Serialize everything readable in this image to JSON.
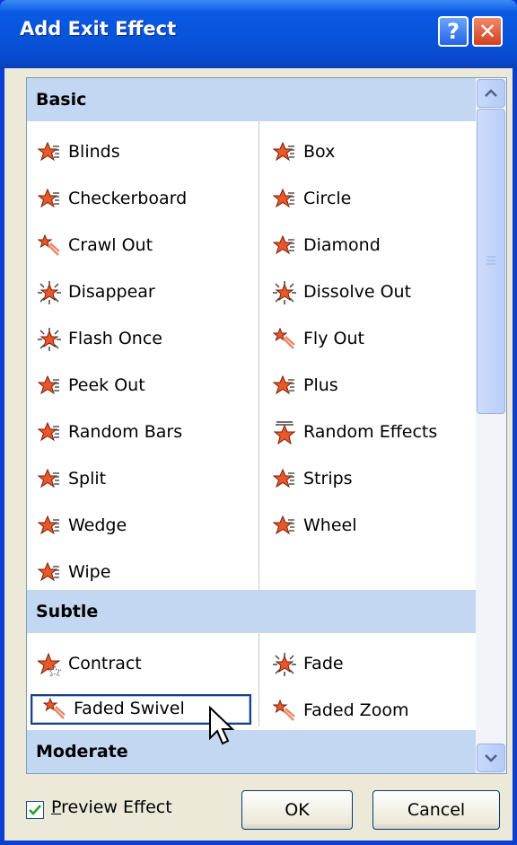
{
  "window": {
    "title": "Add Exit Effect",
    "help_glyph": "?",
    "close_glyph": "✕"
  },
  "list": {
    "categories": [
      {
        "name": "Basic",
        "items": [
          {
            "label": "Blinds",
            "icon": "star-effect-icon"
          },
          {
            "label": "Box",
            "icon": "star-effect-icon"
          },
          {
            "label": "Checkerboard",
            "icon": "star-effect-icon"
          },
          {
            "label": "Circle",
            "icon": "star-effect-icon"
          },
          {
            "label": "Crawl Out",
            "icon": "star-trail-icon"
          },
          {
            "label": "Diamond",
            "icon": "star-effect-icon"
          },
          {
            "label": "Disappear",
            "icon": "star-burst-icon"
          },
          {
            "label": "Dissolve Out",
            "icon": "star-burst-icon"
          },
          {
            "label": "Flash Once",
            "icon": "star-burst-icon"
          },
          {
            "label": "Fly Out",
            "icon": "star-trail-icon"
          },
          {
            "label": "Peek Out",
            "icon": "star-effect-icon"
          },
          {
            "label": "Plus",
            "icon": "star-effect-icon"
          },
          {
            "label": "Random Bars",
            "icon": "star-effect-icon"
          },
          {
            "label": "Random Effects",
            "icon": "star-random-icon"
          },
          {
            "label": "Split",
            "icon": "star-effect-icon"
          },
          {
            "label": "Strips",
            "icon": "star-effect-icon"
          },
          {
            "label": "Wedge",
            "icon": "star-effect-icon"
          },
          {
            "label": "Wheel",
            "icon": "star-effect-icon"
          },
          {
            "label": "Wipe",
            "icon": "star-effect-icon"
          }
        ]
      },
      {
        "name": "Subtle",
        "items": [
          {
            "label": "Contract",
            "icon": "star-contract-icon"
          },
          {
            "label": "Fade",
            "icon": "star-burst-icon"
          },
          {
            "label": "Faded Swivel",
            "icon": "star-trail-icon",
            "selected": true
          },
          {
            "label": "Faded Zoom",
            "icon": "star-trail-icon"
          }
        ]
      },
      {
        "name": "Moderate",
        "items": []
      }
    ]
  },
  "footer": {
    "preview_label_accel": "P",
    "preview_label_rest": "review Effect",
    "preview_checked": true,
    "ok_label": "OK",
    "cancel_label": "Cancel"
  },
  "colors": {
    "titlebar": "#0654d8",
    "category_band": "#c3d7f2",
    "star": "#e8582a",
    "dialog_face": "#ece9d8"
  }
}
